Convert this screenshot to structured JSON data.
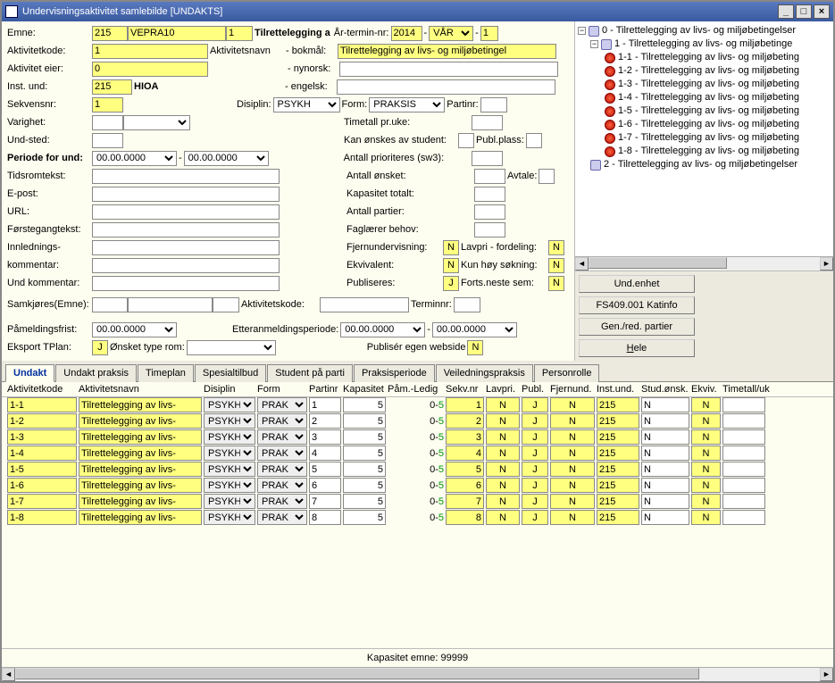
{
  "window": {
    "title": "Undervisningsaktivitet samlebilde   [UNDAKTS]",
    "minimize": "_",
    "maximize": "□",
    "close": "×"
  },
  "form": {
    "emne_label": "Emne:",
    "emne1": "215",
    "emne2": "VEPRA10",
    "emne3": "1",
    "tilrette_label": "Tilrettelegging a",
    "aar_label": "År-termin-nr:",
    "aar": "2014",
    "termin": "VÅR",
    "terminnr": "1",
    "aktkode_label": "Aktivitetkode:",
    "aktkode": "1",
    "aktnavn_label": "Aktivitetsnavn",
    "bokmal_label": "- bokmål:",
    "aktnavn": "Tilrettelegging av livs- og miljøbetingel",
    "akteier_label": "Aktivitet eier:",
    "akteier": "0",
    "nynorsk_label": "- nynorsk:",
    "instund_label": "Inst. und:",
    "instund1": "215",
    "instund_navn": "HIOA",
    "engelsk_label": "- engelsk:",
    "sekvens_label": "Sekvensnr:",
    "sekvens": "1",
    "disiplin_label": "Disiplin:",
    "disiplin": "PSYKH",
    "formp_label": "Form:",
    "formp": "PRAKSIS",
    "partnr_label": "Partinr:",
    "varighet_label": "Varighet:",
    "timetall_label": "Timetall pr.uke:",
    "undsted_label": "Und-sted:",
    "kanonskes_label": "Kan ønskes av student:",
    "publplass_label": "Publ.plass:",
    "periode_label": "Periode for und:",
    "periode1": "00.00.0000",
    "periode2": "00.00.0000",
    "antallpri_label": "Antall prioriteres (sw3):",
    "tidsrom_label": "Tidsromtekst:",
    "antallons_label": "Antall ønsket:",
    "avtale_label": "Avtale:",
    "epost_label": "E-post:",
    "kaptotal_label": "Kapasitet totalt:",
    "url_label": "URL:",
    "antpartier_label": "Antall partier:",
    "forstegang_label": "Førstegangtekst:",
    "faglaerer_label": "Faglærer behov:",
    "innledning_label": "Innlednings-",
    "kommentar_label": "kommentar:",
    "fjernund_label": "Fjernundervisning:",
    "fjernund": "N",
    "lavpri_label": "Lavpri - fordeling:",
    "lavpri": "N",
    "ekviv_label": "Ekvivalent:",
    "ekviv": "N",
    "kunhoy_label": "Kun høy søkning:",
    "kunhoy": "N",
    "publ_label": "Publiseres:",
    "publ": "J",
    "fortsneste_label": "Forts.neste sem:",
    "fortsneste": "N",
    "undkomm_label": "Und kommentar:",
    "samemne_label": "Samkjøres(Emne):",
    "samakode_label": "Aktivitetskode:",
    "samtermin_label": "Terminnr:",
    "pamelding_label": "Påmeldingsfrist:",
    "pamelding": "00.00.0000",
    "etteranm_label": "Etteranmeldingsperiode:",
    "etteranm1": "00.00.0000",
    "etteranm2": "00.00.0000",
    "eksport_label": "Eksport TPlan:",
    "eksport": "J",
    "onskettype_label": "Ønsket type rom:",
    "publegen_label": "Publisér egen webside",
    "publegen": "N"
  },
  "tree": {
    "root": "0 - Tilrettelegging av livs- og miljøbetingelser",
    "n1": "1 - Tilrettelegging av livs- og miljøbetinge",
    "items": [
      "1-1 - Tilrettelegging av livs- og miljøbeting",
      "1-2 - Tilrettelegging av livs- og miljøbeting",
      "1-3 - Tilrettelegging av livs- og miljøbeting",
      "1-4 - Tilrettelegging av livs- og miljøbeting",
      "1-5 - Tilrettelegging av livs- og miljøbeting",
      "1-6 - Tilrettelegging av livs- og miljøbeting",
      "1-7 - Tilrettelegging av livs- og miljøbeting",
      "1-8 - Tilrettelegging av livs- og miljøbeting"
    ],
    "n2": "2 - Tilrettelegging av livs- og miljøbetingelser"
  },
  "buttons": {
    "undenhet": "Und.enhet",
    "katinfo": "FS409.001 Katinfo",
    "genred": "Gen./red. partier",
    "hele": "Hele"
  },
  "tabs": [
    "Undakt",
    "Undakt praksis",
    "Timeplan",
    "Spesialtilbud",
    "Student på parti",
    "Praksisperiode",
    "Veiledningspraksis",
    "Personrolle"
  ],
  "grid": {
    "headers": [
      "Aktivitetkode",
      "Aktivitetsnavn",
      "Disiplin",
      "Form",
      "Partinr",
      "Kapasitet",
      "Påm.-Ledig",
      "Sekv.nr",
      "Lavpri.",
      "Publ.",
      "Fjernund.",
      "Inst.und.",
      "Stud.ønsk.",
      "Ekviv.",
      "Timetall/uk"
    ],
    "rows": [
      {
        "kode": "1-1",
        "navn": "Tilrettelegging av livs-",
        "dis": "PSYKH",
        "form": "PRAK",
        "part": "1",
        "kap": "5",
        "paam": "0",
        "ledig": "5",
        "sekv": "1",
        "lav": "N",
        "publ": "J",
        "fjern": "N",
        "inst": "215",
        "stud": "N",
        "ekv": "N"
      },
      {
        "kode": "1-2",
        "navn": "Tilrettelegging av livs-",
        "dis": "PSYKH",
        "form": "PRAK",
        "part": "2",
        "kap": "5",
        "paam": "0",
        "ledig": "5",
        "sekv": "2",
        "lav": "N",
        "publ": "J",
        "fjern": "N",
        "inst": "215",
        "stud": "N",
        "ekv": "N"
      },
      {
        "kode": "1-3",
        "navn": "Tilrettelegging av livs-",
        "dis": "PSYKH",
        "form": "PRAK",
        "part": "3",
        "kap": "5",
        "paam": "0",
        "ledig": "5",
        "sekv": "3",
        "lav": "N",
        "publ": "J",
        "fjern": "N",
        "inst": "215",
        "stud": "N",
        "ekv": "N"
      },
      {
        "kode": "1-4",
        "navn": "Tilrettelegging av livs-",
        "dis": "PSYKH",
        "form": "PRAK",
        "part": "4",
        "kap": "5",
        "paam": "0",
        "ledig": "5",
        "sekv": "4",
        "lav": "N",
        "publ": "J",
        "fjern": "N",
        "inst": "215",
        "stud": "N",
        "ekv": "N"
      },
      {
        "kode": "1-5",
        "navn": "Tilrettelegging av livs-",
        "dis": "PSYKH",
        "form": "PRAK",
        "part": "5",
        "kap": "5",
        "paam": "0",
        "ledig": "5",
        "sekv": "5",
        "lav": "N",
        "publ": "J",
        "fjern": "N",
        "inst": "215",
        "stud": "N",
        "ekv": "N"
      },
      {
        "kode": "1-6",
        "navn": "Tilrettelegging av livs-",
        "dis": "PSYKH",
        "form": "PRAK",
        "part": "6",
        "kap": "5",
        "paam": "0",
        "ledig": "5",
        "sekv": "6",
        "lav": "N",
        "publ": "J",
        "fjern": "N",
        "inst": "215",
        "stud": "N",
        "ekv": "N"
      },
      {
        "kode": "1-7",
        "navn": "Tilrettelegging av livs-",
        "dis": "PSYKH",
        "form": "PRAK",
        "part": "7",
        "kap": "5",
        "paam": "0",
        "ledig": "5",
        "sekv": "7",
        "lav": "N",
        "publ": "J",
        "fjern": "N",
        "inst": "215",
        "stud": "N",
        "ekv": "N"
      },
      {
        "kode": "1-8",
        "navn": "Tilrettelegging av livs-",
        "dis": "PSYKH",
        "form": "PRAK",
        "part": "8",
        "kap": "5",
        "paam": "0",
        "ledig": "5",
        "sekv": "8",
        "lav": "N",
        "publ": "J",
        "fjern": "N",
        "inst": "215",
        "stud": "N",
        "ekv": "N"
      }
    ],
    "footer": "Kapasitet emne: 99999"
  }
}
